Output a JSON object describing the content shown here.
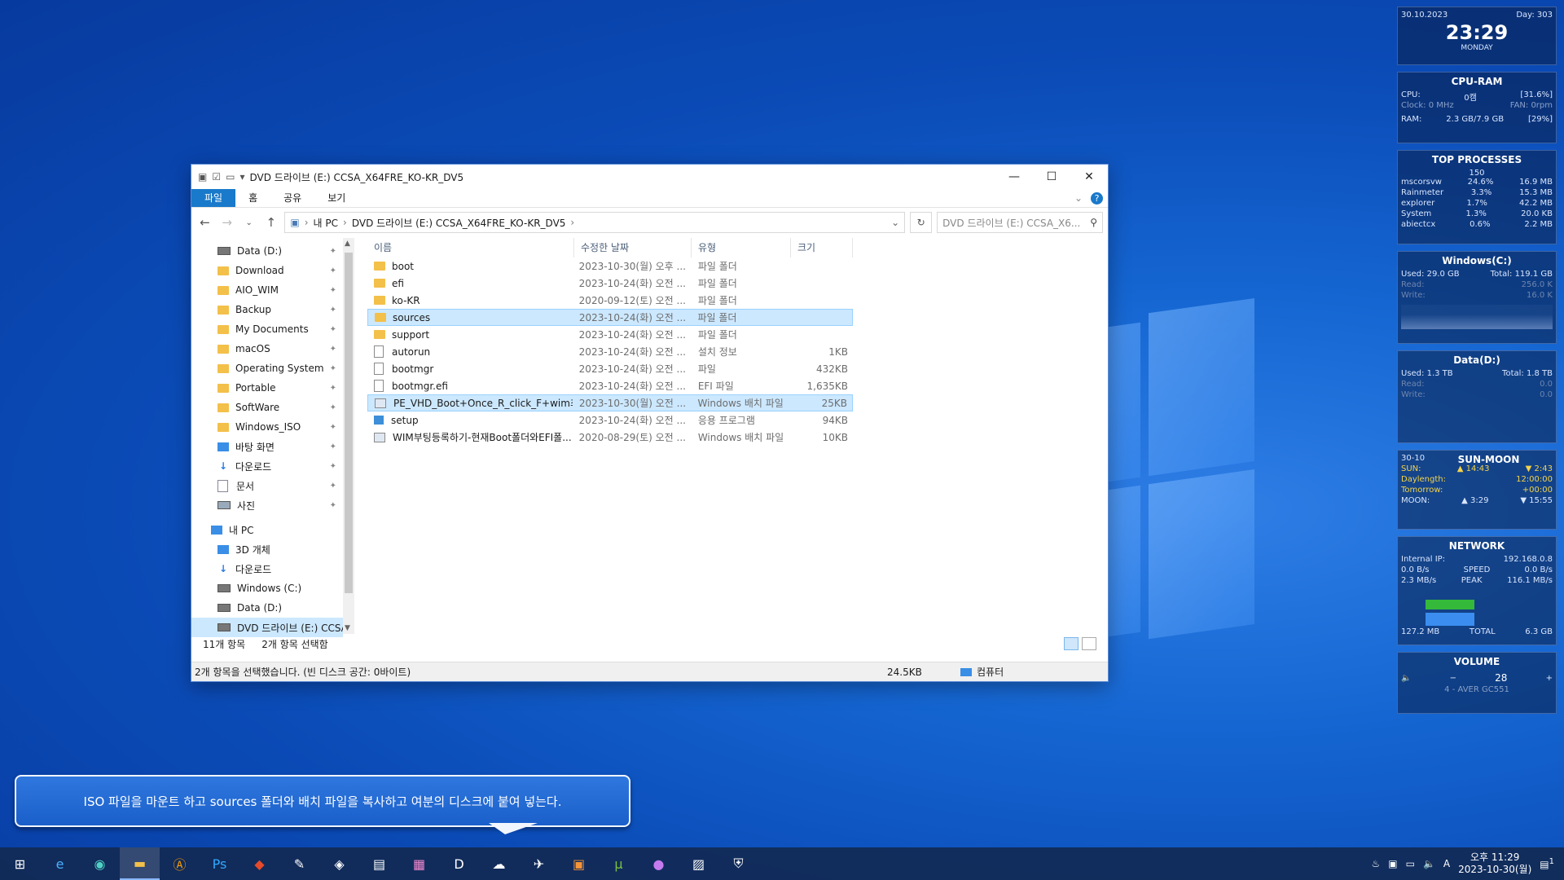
{
  "window": {
    "title": "DVD 드라이브 (E:) CCSA_X64FRE_KO-KR_DV5",
    "ribbon_tabs": [
      "파일",
      "홈",
      "공유",
      "보기"
    ],
    "path": [
      "내 PC",
      "DVD 드라이브 (E:) CCSA_X64FRE_KO-KR_DV5"
    ],
    "search_placeholder": "DVD 드라이브 (E:) CCSA_X6..."
  },
  "nav_items": [
    {
      "label": "Data (D:)",
      "icon": "drive-icon",
      "pinned": true
    },
    {
      "label": "Download",
      "icon": "folder-icon",
      "pinned": true
    },
    {
      "label": "AIO_WIM",
      "icon": "folder-icon",
      "pinned": true
    },
    {
      "label": "Backup",
      "icon": "folder-icon",
      "pinned": true
    },
    {
      "label": "My Documents",
      "icon": "folder-icon",
      "pinned": true
    },
    {
      "label": "macOS",
      "icon": "folder-icon",
      "pinned": true
    },
    {
      "label": "Operating System",
      "icon": "folder-icon",
      "pinned": true
    },
    {
      "label": "Portable",
      "icon": "folder-icon",
      "pinned": true
    },
    {
      "label": "SoftWare",
      "icon": "folder-icon",
      "pinned": true
    },
    {
      "label": "Windows_ISO",
      "icon": "folder-icon",
      "pinned": true
    },
    {
      "label": "바탕 화면",
      "icon": "desktop-icon",
      "pinned": true
    },
    {
      "label": "다운로드",
      "icon": "download-icon",
      "pinned": true
    },
    {
      "label": "문서",
      "icon": "document-icon",
      "pinned": true
    },
    {
      "label": "사진",
      "icon": "pictures-icon",
      "pinned": true
    }
  ],
  "pc_section": {
    "label": "내 PC",
    "items": [
      "3D 개체",
      "다운로드",
      "Windows (C:)",
      "Data (D:)",
      "DVD 드라이브 (E:) CCSA"
    ]
  },
  "columns": {
    "name": "이름",
    "modified": "수정한 날짜",
    "type": "유형",
    "size": "크기"
  },
  "files": [
    {
      "name": "boot",
      "modified": "2023-10-30(월) 오후 ...",
      "type": "파일 폴더",
      "size": "",
      "icon": "folder-icon"
    },
    {
      "name": "efi",
      "modified": "2023-10-24(화) 오전 ...",
      "type": "파일 폴더",
      "size": "",
      "icon": "folder-icon"
    },
    {
      "name": "ko-KR",
      "modified": "2020-09-12(토) 오전 ...",
      "type": "파일 폴더",
      "size": "",
      "icon": "folder-icon"
    },
    {
      "name": "sources",
      "modified": "2023-10-24(화) 오전 ...",
      "type": "파일 폴더",
      "size": "",
      "icon": "folder-icon",
      "selected": true
    },
    {
      "name": "support",
      "modified": "2023-10-24(화) 오전 ...",
      "type": "파일 폴더",
      "size": "",
      "icon": "folder-icon"
    },
    {
      "name": "autorun",
      "modified": "2023-10-24(화) 오전 ...",
      "type": "설치 정보",
      "size": "1KB",
      "icon": "settings-file-icon"
    },
    {
      "name": "bootmgr",
      "modified": "2023-10-24(화) 오전 ...",
      "type": "파일",
      "size": "432KB",
      "icon": "file-icon"
    },
    {
      "name": "bootmgr.efi",
      "modified": "2023-10-24(화) 오전 ...",
      "type": "EFI 파일",
      "size": "1,635KB",
      "icon": "file-icon"
    },
    {
      "name": "PE_VHD_Boot+Once_R_click_F+wim최적...",
      "modified": "2023-10-30(월) 오전 ...",
      "type": "Windows 배치 파일",
      "size": "25KB",
      "icon": "batch-file-icon",
      "selected": true
    },
    {
      "name": "setup",
      "modified": "2023-10-24(화) 오전 ...",
      "type": "응용 프로그램",
      "size": "94KB",
      "icon": "setup-app-icon"
    },
    {
      "name": "WIM부팅등록하기-현재Boot폴더와EFI폴...",
      "modified": "2020-08-29(토) 오전 ...",
      "type": "Windows 배치 파일",
      "size": "10KB",
      "icon": "batch-file-icon"
    }
  ],
  "status": {
    "count": "11개 항목",
    "selected": "2개 항목 선택함",
    "bar_text": "2개 항목을 선택했습니다. (빈 디스크 공간: 0바이트)",
    "bar_size": "24.5KB",
    "bar_location": "컴퓨터"
  },
  "caption": "ISO 파일을 마운트 하고 sources 폴더와 배치 파일을 복사하고 여분의 디스크에 붙여 넣는다.",
  "widgets": {
    "date": "30.10.2023",
    "day": "Day: 303",
    "time": "23:29",
    "weekday": "MONDAY",
    "cpu_ram": {
      "title": "CPU-RAM",
      "cpu_label": "CPU:",
      "cpu_val": "0캠",
      "cpu_pct": "[31.6%]",
      "clock": "Clock: 0 MHz",
      "fan": "FAN: 0rpm",
      "ram_label": "RAM:",
      "ram_val": "2.3 GB/7.9 GB",
      "ram_pct": "[29%]"
    },
    "top_processes": {
      "title": "TOP PROCESSES",
      "count": "150",
      "rows": [
        {
          "name": "mscorsvw",
          "cpu": "24.6%",
          "mem": "16.9 MB"
        },
        {
          "name": "Rainmeter",
          "cpu": "3.3%",
          "mem": "15.3 MB"
        },
        {
          "name": "explorer",
          "cpu": "1.7%",
          "mem": "42.2 MB"
        },
        {
          "name": "System",
          "cpu": "1.3%",
          "mem": "20.0 KB"
        },
        {
          "name": "abiectcx",
          "cpu": "0.6%",
          "mem": "2.2 MB"
        }
      ]
    },
    "disk_c": {
      "title": "Windows(C:)",
      "used": "Used: 29.0 GB",
      "total": "Total: 119.1 GB",
      "read": "Read:",
      "read_val": "256.0 K",
      "write": "Write:",
      "write_val": "16.0 K"
    },
    "disk_d": {
      "title": "Data(D:)",
      "used": "Used: 1.3 TB",
      "total": "Total: 1.8 TB",
      "read": "Read:",
      "read_val": "0.0",
      "write": "Write:",
      "write_val": "0.0"
    },
    "sun_moon": {
      "title": "SUN-MOON",
      "date": "30-10",
      "sun": "SUN:",
      "sunrise": "▲ 14:43",
      "sunset": "▼ 2:43",
      "daylength_label": "Daylength:",
      "daylength": "12:00:00",
      "tomorrow_label": "Tomorrow:",
      "tomorrow": "+00:00",
      "moon": "MOON:",
      "moonrise": "▲ 3:29",
      "moonset": "▼ 15:55"
    },
    "network": {
      "title": "NETWORK",
      "ip_label": "Internal IP:",
      "ip": "192.168.0.8",
      "down": "0.0 B/s",
      "speed_label": "SPEED",
      "up": "0.0 B/s",
      "peak_down": "2.3 MB/s",
      "peak_label": "PEAK",
      "peak_up": "116.1 MB/s",
      "total_down": "127.2 MB",
      "total_label": "TOTAL",
      "total_up": "6.3 GB"
    },
    "volume": {
      "title": "VOLUME",
      "level": "28",
      "device": "4 - AVER GC551"
    }
  },
  "taskbar": {
    "clock_time": "오후 11:29",
    "clock_date": "2023-10-30(월)",
    "ime": "A",
    "notif": "1"
  }
}
